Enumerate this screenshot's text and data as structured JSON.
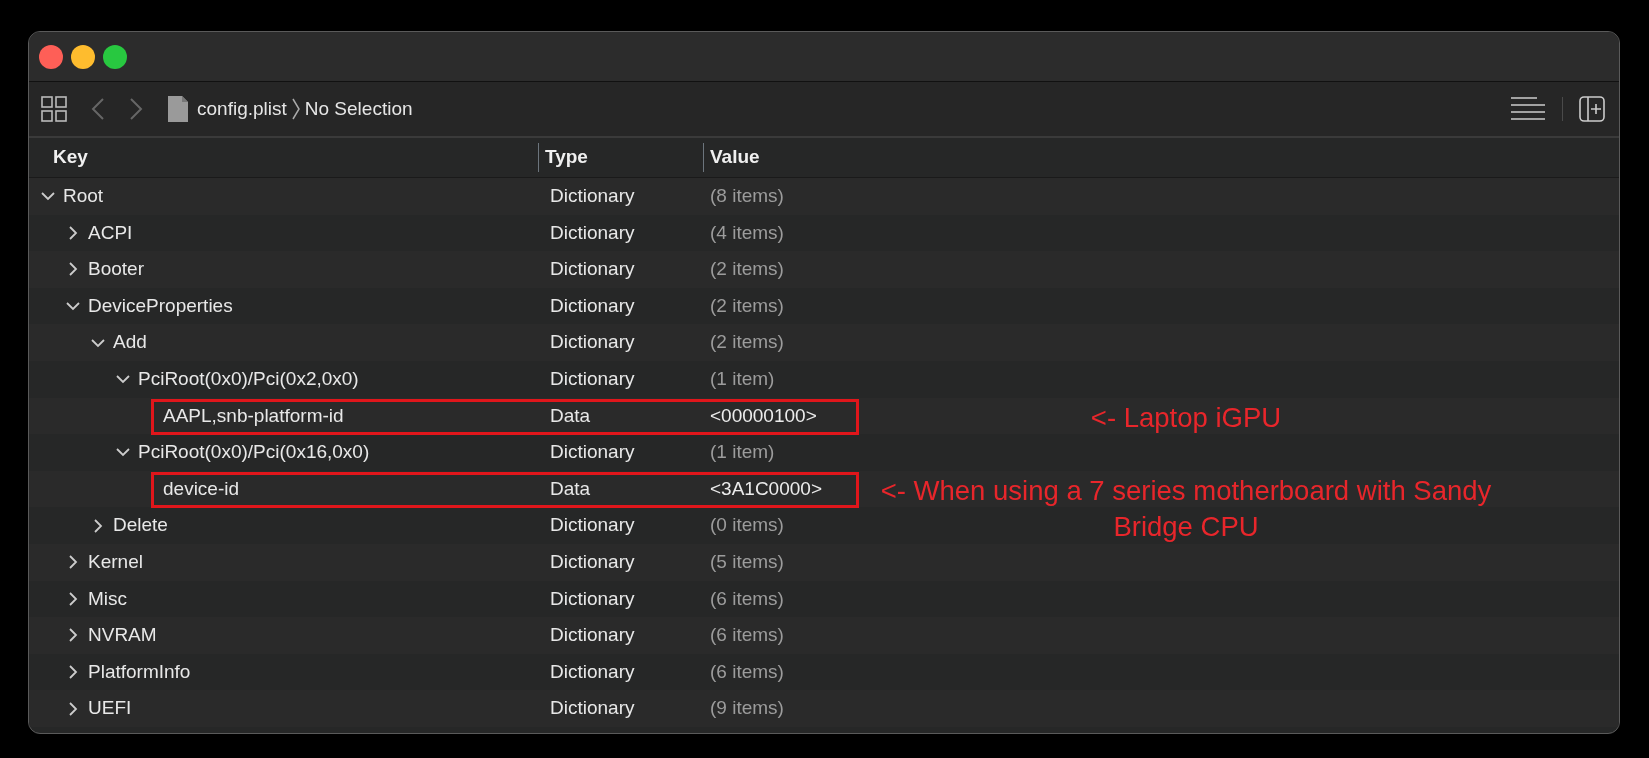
{
  "toolbar": {
    "breadcrumb": [
      "config.plist",
      "No Selection"
    ]
  },
  "columns": [
    "Key",
    "Type",
    "Value"
  ],
  "rows": [
    {
      "key": "Root",
      "type": "Dictionary",
      "value": "(8 items)",
      "expanded": true,
      "children": [
        {
          "key": "ACPI",
          "type": "Dictionary",
          "value": "(4 items)",
          "expanded": false
        },
        {
          "key": "Booter",
          "type": "Dictionary",
          "value": "(2 items)",
          "expanded": false
        },
        {
          "key": "DeviceProperties",
          "type": "Dictionary",
          "value": "(2 items)",
          "expanded": true,
          "children": [
            {
              "key": "Add",
              "type": "Dictionary",
              "value": "(2 items)",
              "expanded": true,
              "children": [
                {
                  "key": "PciRoot(0x0)/Pci(0x2,0x0)",
                  "type": "Dictionary",
                  "value": "(1 item)",
                  "expanded": true,
                  "children": [
                    {
                      "key": "AAPL,snb-platform-id",
                      "type": "Data",
                      "value": "<00000100>",
                      "highlighted": true,
                      "annotation": [
                        "<- Laptop iGPU"
                      ]
                    }
                  ]
                },
                {
                  "key": "PciRoot(0x0)/Pci(0x16,0x0)",
                  "type": "Dictionary",
                  "value": "(1 item)",
                  "expanded": true,
                  "children": [
                    {
                      "key": "device-id",
                      "type": "Data",
                      "value": "<3A1C0000>",
                      "highlighted": true,
                      "annotation": [
                        "<- When using a 7 series motherboard with Sandy",
                        "Bridge CPU"
                      ]
                    }
                  ]
                }
              ]
            },
            {
              "key": "Delete",
              "type": "Dictionary",
              "value": "(0 items)",
              "expanded": false
            }
          ]
        },
        {
          "key": "Kernel",
          "type": "Dictionary",
          "value": "(5 items)",
          "expanded": false
        },
        {
          "key": "Misc",
          "type": "Dictionary",
          "value": "(6 items)",
          "expanded": false
        },
        {
          "key": "NVRAM",
          "type": "Dictionary",
          "value": "(6 items)",
          "expanded": false
        },
        {
          "key": "PlatformInfo",
          "type": "Dictionary",
          "value": "(6 items)",
          "expanded": false
        },
        {
          "key": "UEFI",
          "type": "Dictionary",
          "value": "(9 items)",
          "expanded": false
        }
      ]
    }
  ]
}
